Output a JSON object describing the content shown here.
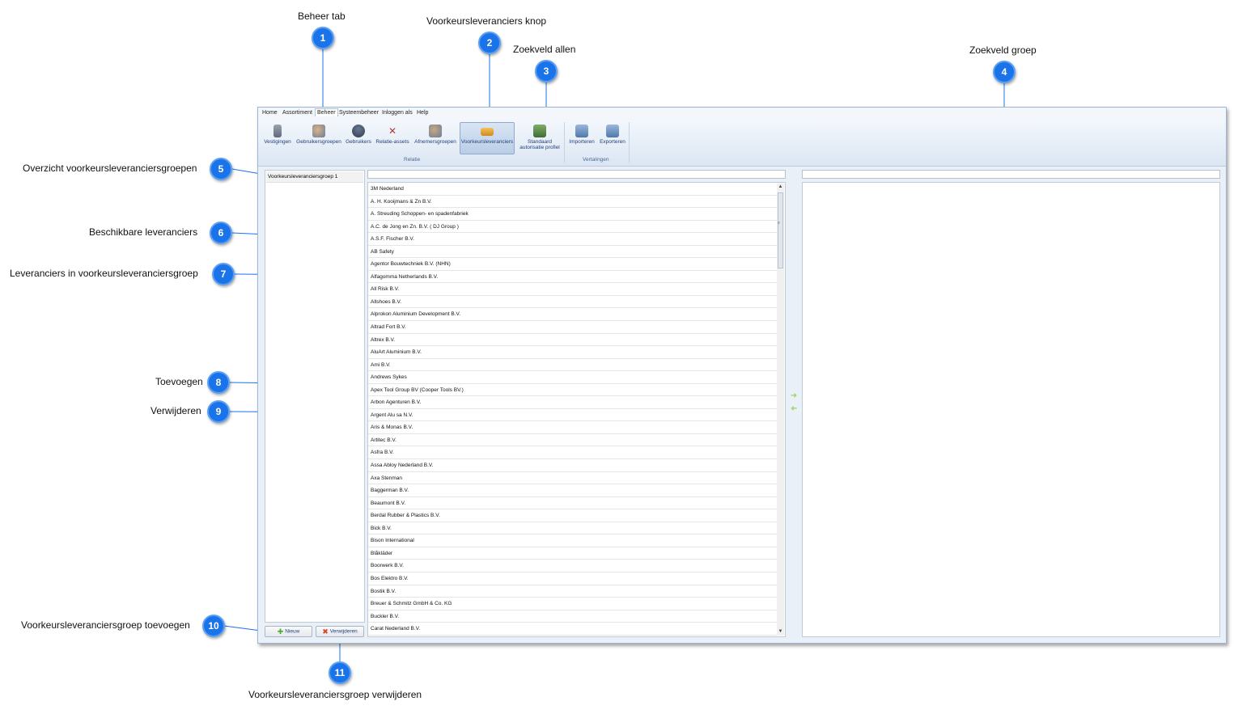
{
  "annotations": [
    {
      "num": "1",
      "label": "Beheer tab"
    },
    {
      "num": "2",
      "label": "Voorkeursleveranciers knop"
    },
    {
      "num": "3",
      "label": "Zoekveld allen"
    },
    {
      "num": "4",
      "label": "Zoekveld groep"
    },
    {
      "num": "5",
      "label": "Overzicht voorkeursleveranciersgroepen"
    },
    {
      "num": "6",
      "label": "Beschikbare leveranciers"
    },
    {
      "num": "7",
      "label": "Leveranciers in voorkeursleveranciersgroep"
    },
    {
      "num": "8",
      "label": "Toevoegen"
    },
    {
      "num": "9",
      "label": "Verwijderen"
    },
    {
      "num": "10",
      "label": "Voorkeursleveranciersgroep toevoegen"
    },
    {
      "num": "11",
      "label": "Voorkeursleveranciersgroep verwijderen"
    }
  ],
  "menu": [
    "Home",
    "Assortiment",
    "Beheer",
    "Systeembeheer",
    "Inloggen als",
    "Help"
  ],
  "ribbon": {
    "buttons": [
      {
        "label": "Vestigingen",
        "icon": "building-icon"
      },
      {
        "label": "Gebruikersgroepen",
        "icon": "user-group-icon"
      },
      {
        "label": "Gebruikers",
        "icon": "user-icon"
      },
      {
        "label": "Relatie-assets",
        "icon": "tools-icon"
      },
      {
        "label": "Afnemersgroepen",
        "icon": "customer-group-icon"
      },
      {
        "label": "Voorkeursleveranciers",
        "icon": "truck-icon"
      },
      {
        "label": "Standaard",
        "label2": "autorisatie profiel",
        "icon": "auth-profile-icon"
      },
      {
        "label": "Importeren",
        "icon": "import-icon"
      },
      {
        "label": "Exporteren",
        "icon": "export-icon"
      }
    ],
    "groups": [
      "Relatie",
      "Vertalingen"
    ]
  },
  "groups_list": [
    "Voorkeursleveranciersgroep 1"
  ],
  "search": {
    "all_value": "",
    "group_value": ""
  },
  "suppliers": [
    "3M Nederland",
    "A. H. Kooijmans & Zn B.V.",
    "A. Streuding Schoppen- en spadenfabriek",
    "A.C. de Jong en Zn. B.V. ( DJ Group )",
    "A.S.F. Fischer B.V.",
    "AB Safety",
    "Agentor Bouwtechniek B.V. (NHN)",
    "Alfagomma Netherlands B.V.",
    "All Risk B.V.",
    "Allshoes B.V.",
    "Alprokon Aluminium Development B.V.",
    "Altrad Fort B.V.",
    "Altrex B.V.",
    "AluArt Aluminium B.V.",
    "Ami B.V.",
    "Andrews Sykes",
    "Apex Tool Group BV (Cooper Tools BV.)",
    "Arbon Agenturen B.V.",
    "Argent Alu sa N.V.",
    "Aris & Monas B.V.",
    "Artitec B.V.",
    "Asfra B.V.",
    "Assa Abloy Nederland B.V.",
    "Axa Stenman",
    "Baggerman B.V.",
    "Beaumont B.V.",
    "Berdal Rubber & Plastics B.V.",
    "Bick B.V.",
    "Bison International",
    "Blåkläder",
    "Boorwerk B.V.",
    "Bos Elektro B.V.",
    "Bostik B.V.",
    "Breuer & Schmitz GmbH & Co. KG",
    "Buckler B.V.",
    "Carat Nederland B.V."
  ],
  "group_suppliers": [],
  "buttons": {
    "new": "Nieuw",
    "delete": "Verwijderen"
  },
  "colors": {
    "badge": "#1a73e8",
    "accent": "#1e3f7a",
    "selected": "#b9cde6"
  }
}
